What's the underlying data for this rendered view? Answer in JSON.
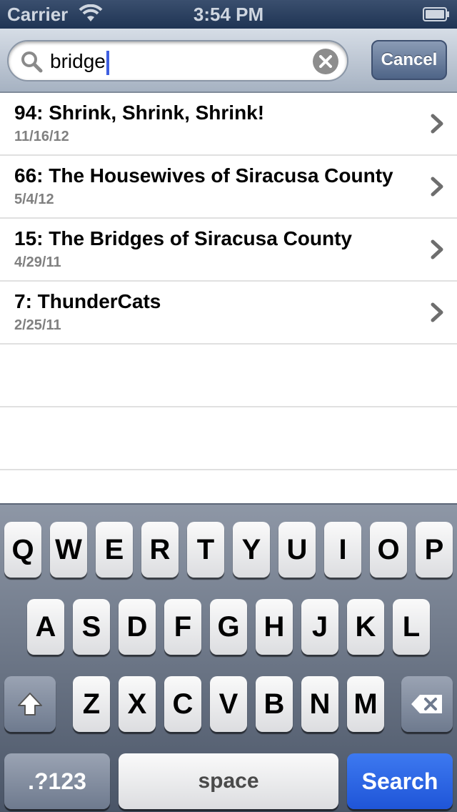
{
  "status_bar": {
    "carrier": "Carrier",
    "time": "3:54 PM",
    "wifi_icon": "wifi-icon",
    "battery_icon": "battery-icon"
  },
  "search": {
    "value": "bridge",
    "cancel_label": "Cancel",
    "search_icon": "search-icon",
    "clear_icon": "clear-icon"
  },
  "results": [
    {
      "title": "94: Shrink, Shrink, Shrink!",
      "date": "11/16/12"
    },
    {
      "title": "66: The Housewives of Siracusa County",
      "date": "5/4/12"
    },
    {
      "title": "15: The Bridges of Siracusa County",
      "date": "4/29/11"
    },
    {
      "title": "7: ThunderCats",
      "date": "2/25/11"
    }
  ],
  "keyboard": {
    "row1": [
      "Q",
      "W",
      "E",
      "R",
      "T",
      "Y",
      "U",
      "I",
      "O",
      "P"
    ],
    "row2": [
      "A",
      "S",
      "D",
      "F",
      "G",
      "H",
      "J",
      "K",
      "L"
    ],
    "row3": [
      "Z",
      "X",
      "C",
      "V",
      "B",
      "N",
      "M"
    ],
    "numbers_label": ".?123",
    "space_label": "space",
    "search_label": "Search",
    "shift_icon": "shift-icon",
    "delete_icon": "delete-icon"
  },
  "colors": {
    "accent_blue": "#2a62e6",
    "cancel_button": "#5b7194",
    "caret": "#3f5fe0"
  }
}
